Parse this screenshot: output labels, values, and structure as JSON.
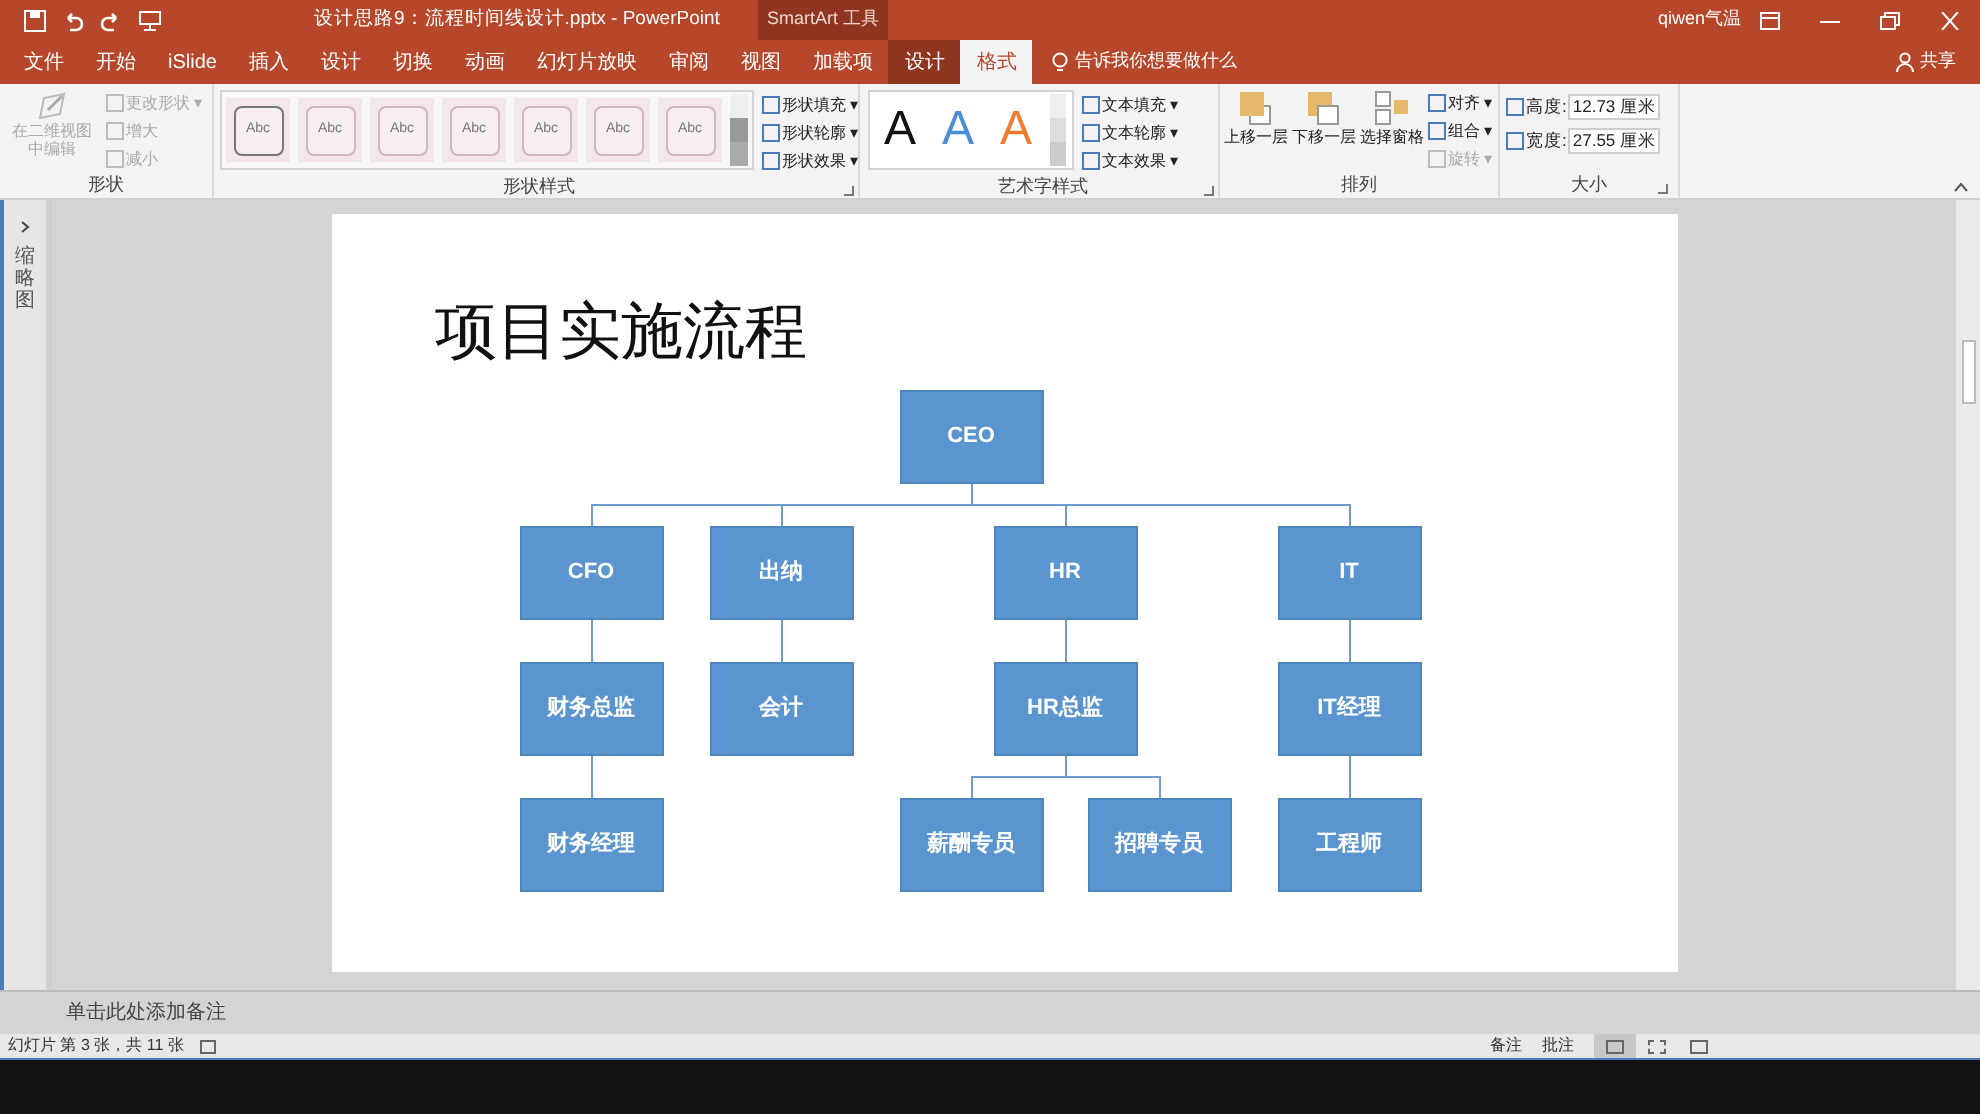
{
  "window": {
    "title": "设计思路9：流程时间线设计.pptx  -  PowerPoint",
    "context_label": "SmartArt 工具",
    "user": "qiwen气温"
  },
  "tabs": [
    {
      "label": "文件",
      "kind": "file",
      "selected": false
    },
    {
      "label": "开始",
      "kind": "normal",
      "selected": false
    },
    {
      "label": "iSlide",
      "kind": "normal",
      "selected": false
    },
    {
      "label": "插入",
      "kind": "normal",
      "selected": false
    },
    {
      "label": "设计",
      "kind": "normal",
      "selected": false
    },
    {
      "label": "切换",
      "kind": "normal",
      "selected": false
    },
    {
      "label": "动画",
      "kind": "normal",
      "selected": false
    },
    {
      "label": "幻灯片放映",
      "kind": "normal",
      "selected": false
    },
    {
      "label": "审阅",
      "kind": "normal",
      "selected": false
    },
    {
      "label": "视图",
      "kind": "normal",
      "selected": false
    },
    {
      "label": "加载项",
      "kind": "normal",
      "selected": false
    },
    {
      "label": "设计",
      "kind": "contextual",
      "selected": false
    },
    {
      "label": "格式",
      "kind": "contextual",
      "selected": true
    }
  ],
  "tell_me": {
    "placeholder": "告诉我你想要做什么"
  },
  "share": "共享",
  "ribbon": {
    "shapes": {
      "label": "形状",
      "edit_2d": {
        "label": "在二维视图中编辑",
        "disabled": true
      },
      "items": [
        {
          "label": "更改形状 ▾",
          "disabled": true
        },
        {
          "label": "增大",
          "disabled": true
        },
        {
          "label": "减小",
          "disabled": true
        }
      ]
    },
    "shape_styles": {
      "label": "形状样式",
      "gallery": [
        {
          "text": "Abc",
          "selected": true
        },
        {
          "text": "Abc",
          "selected": false
        },
        {
          "text": "Abc",
          "selected": false
        },
        {
          "text": "Abc",
          "selected": false
        },
        {
          "text": "Abc",
          "selected": false
        },
        {
          "text": "Abc",
          "selected": false
        },
        {
          "text": "Abc",
          "selected": false
        }
      ],
      "commands": [
        "形状填充 ▾",
        "形状轮廓 ▾",
        "形状效果 ▾"
      ]
    },
    "wordart_styles": {
      "label": "艺术字样式",
      "gallery": [
        {
          "text": "A",
          "color": "#111111"
        },
        {
          "text": "A",
          "color": "#4a8fd6"
        },
        {
          "text": "A",
          "color": "#ee7b2f"
        }
      ],
      "commands": [
        "文本填充 ▾",
        "文本轮廓 ▾",
        "文本效果 ▾"
      ]
    },
    "arrange": {
      "label": "排列",
      "large": [
        {
          "label": "上移一层",
          "kind": "forward"
        },
        {
          "label": "下移一层",
          "kind": "backward"
        },
        {
          "label": "选择窗格",
          "kind": "pane"
        }
      ],
      "small": [
        {
          "label": "对齐 ▾",
          "disabled": false
        },
        {
          "label": "组合 ▾",
          "disabled": false
        },
        {
          "label": "旋转 ▾",
          "disabled": true
        }
      ]
    },
    "size": {
      "label": "大小",
      "fields": [
        {
          "label": "高度:",
          "value": "12.73 厘米"
        },
        {
          "label": "宽度:",
          "value": "27.55 厘米"
        }
      ]
    }
  },
  "thumbnail_pane": {
    "label": "缩略图"
  },
  "slide": {
    "title": "项目实施流程",
    "org_chart": {
      "text": "CEO",
      "children": [
        {
          "text": "CFO",
          "children": [
            {
              "text": "财务总监",
              "children": [
                {
                  "text": "财务经理"
                }
              ]
            }
          ]
        },
        {
          "text": "出纳",
          "children": [
            {
              "text": "会计"
            }
          ]
        },
        {
          "text": "HR",
          "children": [
            {
              "text": "HR总监",
              "children": [
                {
                  "text": "薪酬专员"
                },
                {
                  "text": "招聘专员"
                }
              ]
            }
          ]
        },
        {
          "text": "IT",
          "children": [
            {
              "text": "IT经理",
              "children": [
                {
                  "text": "工程师"
                }
              ]
            }
          ]
        }
      ]
    }
  },
  "notes": {
    "placeholder": "单击此处添加备注"
  },
  "status_bar": {
    "slide_info": "幻灯片 第 3 张，共 11 张",
    "notes_button": "备注",
    "comments_button": "批注",
    "views": [
      {
        "kind": "normal",
        "selected": true
      },
      {
        "kind": "sorter",
        "selected": false
      },
      {
        "kind": "reading",
        "selected": false
      }
    ]
  }
}
